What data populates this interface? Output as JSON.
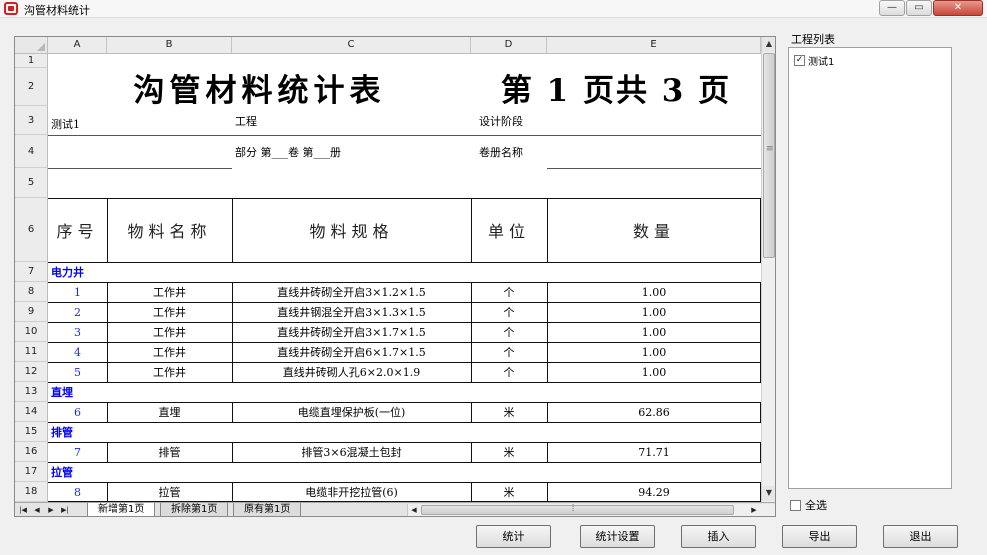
{
  "window": {
    "title": "沟管材料统计",
    "min_symbol": "—",
    "max_symbol": "▭",
    "close_symbol": "✕"
  },
  "sheet": {
    "columns": [
      "A",
      "B",
      "C",
      "D",
      "E"
    ],
    "row_numbers": [
      "1",
      "2",
      "3",
      "4",
      "5",
      "6",
      "7",
      "8",
      "9",
      "10",
      "11",
      "12",
      "13",
      "14",
      "15",
      "16",
      "17",
      "18"
    ],
    "title": "沟管材料统计表",
    "page_info": "第 1 页共 3 页",
    "project_name": "测试1",
    "project_label": "工程",
    "design_stage_label": "设计阶段",
    "part_label": "部分 第___卷 第___册",
    "volume_name_label": "卷册名称",
    "headers": {
      "seq": "序号",
      "name": "物料名称",
      "spec": "物料规格",
      "unit": "单位",
      "qty": "数量"
    },
    "sections": [
      {
        "title": "电力井"
      },
      {
        "title": "直埋"
      },
      {
        "title": "排管"
      },
      {
        "title": "拉管"
      }
    ],
    "rows": [
      {
        "seq": "1",
        "name": "工作井",
        "spec": "直线井砖砌全开启3×1.2×1.5",
        "unit": "个",
        "qty": "1.00"
      },
      {
        "seq": "2",
        "name": "工作井",
        "spec": "直线井钢混全开启3×1.3×1.5",
        "unit": "个",
        "qty": "1.00"
      },
      {
        "seq": "3",
        "name": "工作井",
        "spec": "直线井砖砌全开启3×1.7×1.5",
        "unit": "个",
        "qty": "1.00"
      },
      {
        "seq": "4",
        "name": "工作井",
        "spec": "直线井砖砌全开启6×1.7×1.5",
        "unit": "个",
        "qty": "1.00"
      },
      {
        "seq": "5",
        "name": "工作井",
        "spec": "直线井砖砌人孔6×2.0×1.9",
        "unit": "个",
        "qty": "1.00"
      },
      {
        "seq": "6",
        "name": "直埋",
        "spec": "电缆直埋保护板(一位)",
        "unit": "米",
        "qty": "62.86"
      },
      {
        "seq": "7",
        "name": "排管",
        "spec": "排管3×6混凝土包封",
        "unit": "米",
        "qty": "71.71"
      },
      {
        "seq": "8",
        "name": "拉管",
        "spec": "电缆非开挖拉管(6)",
        "unit": "米",
        "qty": "94.29"
      }
    ],
    "tabs": [
      "新增第1页",
      "拆除第1页",
      "原有第1页"
    ],
    "nav_symbols": [
      "|◀",
      "◀",
      "▶",
      "▶|"
    ],
    "scroll": {
      "up": "▲",
      "down": "▼",
      "left": "◀",
      "right": "▶"
    }
  },
  "side_panel": {
    "label": "工程列表",
    "items": [
      {
        "label": "测试1",
        "checked": true
      }
    ],
    "check_mark": "✓",
    "select_all_label": "全选"
  },
  "buttons": {
    "stats": "统计",
    "stats_settings": "统计设置",
    "insert": "插入",
    "export": "导出",
    "exit": "退出"
  }
}
